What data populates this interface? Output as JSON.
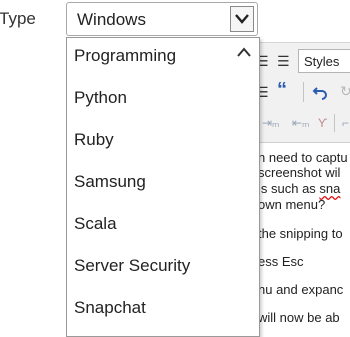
{
  "field": {
    "label": "Type",
    "selected": "Windows"
  },
  "dropdown": {
    "options": [
      "Programming",
      "Python",
      "Ruby",
      "Samsung",
      "Scala",
      "Server Security",
      "Snapchat"
    ]
  },
  "editor": {
    "styles_label": "Styles",
    "lines": [
      "n need to captu",
      "screenshot wil",
      "ls such as ",
      "own menu?",
      "the snipping to",
      "ess Esc",
      "nu and expanc",
      " will now be ab"
    ],
    "spell_word": "sna"
  },
  "colors": {
    "accent_blue": "#1e5bb8",
    "border": "#a9a9a9"
  },
  "icons": [
    "chevron-down-icon",
    "chevron-up-icon",
    "quote-icon",
    "undo-icon",
    "align-icon",
    "list-icon"
  ]
}
